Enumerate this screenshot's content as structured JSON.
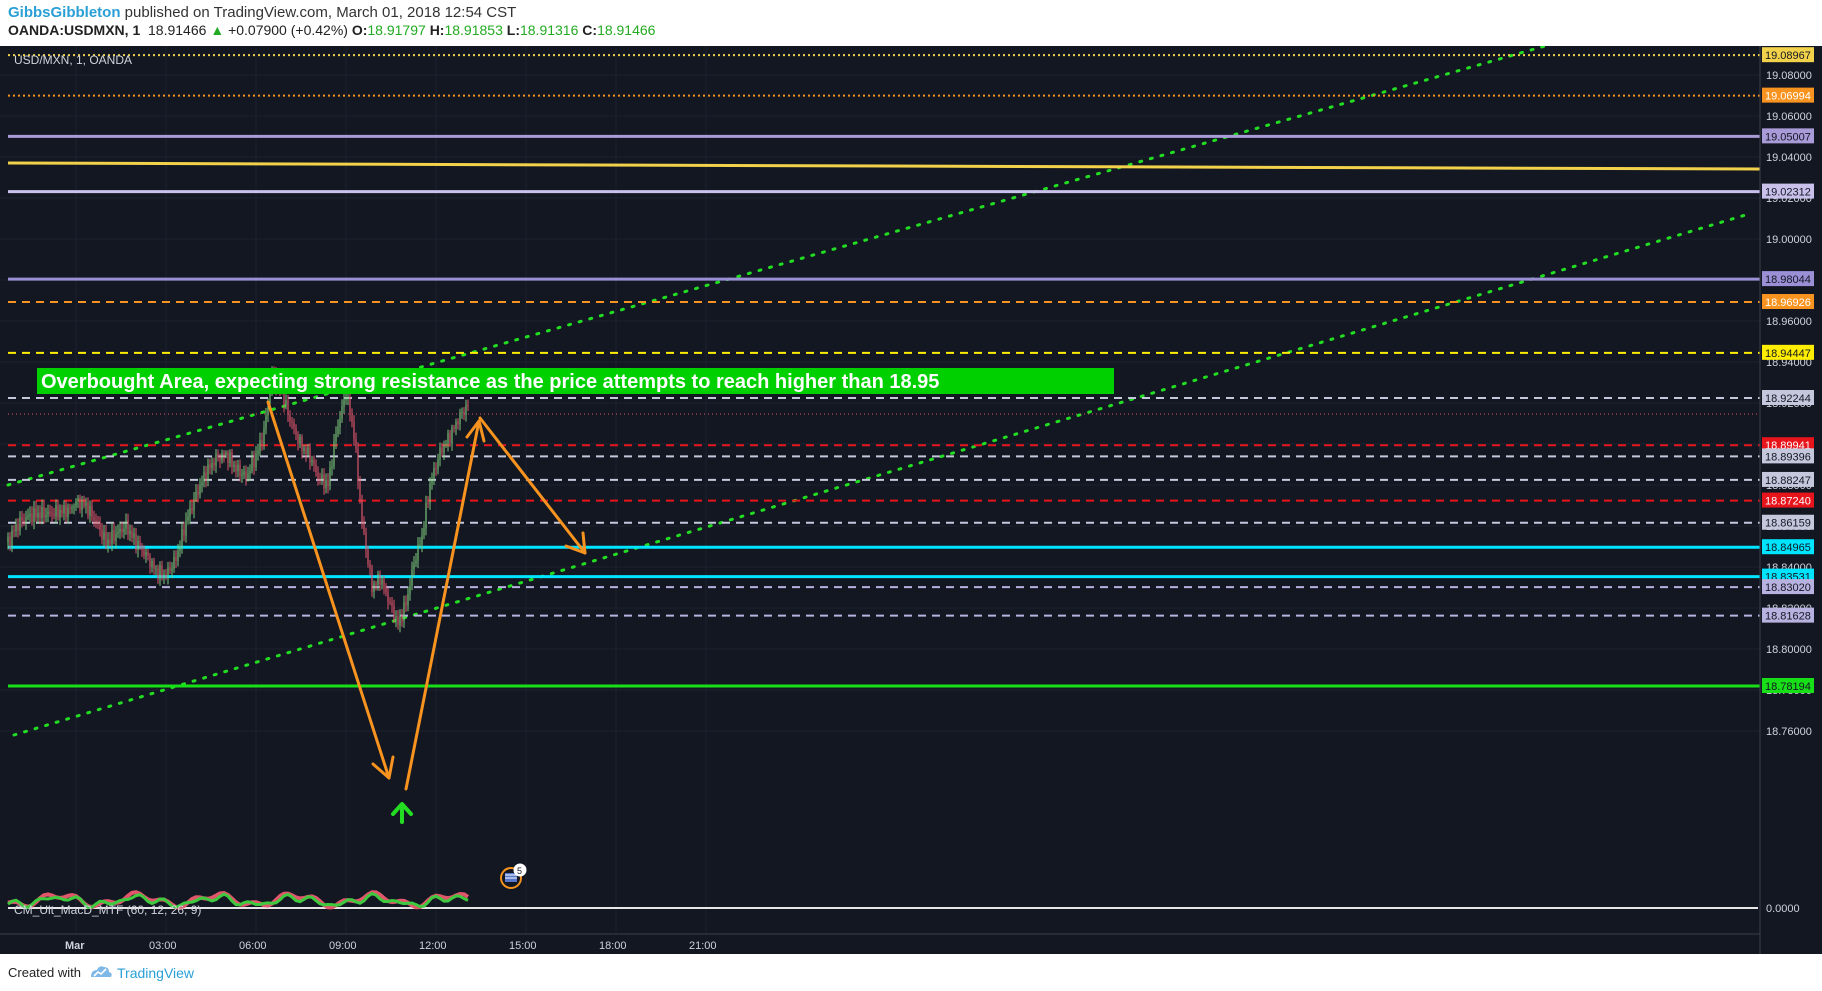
{
  "header": {
    "author": "GibbsGibbleton",
    "published_text": " published on TradingView.com, March 01, 2018 12:54 CST",
    "symbol": "OANDA:USDMXN, 1",
    "last": "18.91466",
    "change": "+0.07900 (+0.42%)",
    "open_label": "O:",
    "open": "18.91797",
    "high_label": "H:",
    "high": "18.91853",
    "low_label": "L:",
    "low": "18.91316",
    "close_label": "C:",
    "close": "18.91466"
  },
  "chart": {
    "pane_title": "USD/MXN, 1, OANDA",
    "annotation": "Overbought Area, expecting strong resistance as the price attempts to reach higher than 18.95",
    "indicator_label": "CM_Ult_MacD_MTF (60, 12, 26, 9)",
    "indicator_zero": "0.0000",
    "event_badge_count": "5",
    "price_axis": [
      "19.08000",
      "19.06000",
      "19.04000",
      "19.02000",
      "19.00000",
      "18.98000",
      "18.96000",
      "18.94000",
      "18.92000",
      "18.90000",
      "18.88000",
      "18.86000",
      "18.84000",
      "18.82000",
      "18.80000",
      "18.78000",
      "18.76000"
    ],
    "time_axis": [
      "Mar",
      "03:00",
      "06:00",
      "09:00",
      "12:00",
      "15:00",
      "18:00",
      "21:00"
    ],
    "levels": [
      {
        "value": "19.08967",
        "color": "#f2d24b",
        "style": "dotted"
      },
      {
        "value": "19.06994",
        "color": "#f7931e",
        "style": "dotted"
      },
      {
        "value": "19.05007",
        "color": "#a99bd8",
        "style": "solid"
      },
      {
        "value": "19.02312",
        "color": "#c9c1ec",
        "style": "solid"
      },
      {
        "value": "18.98044",
        "color": "#9b8fd6",
        "style": "solid"
      },
      {
        "value": "18.96926",
        "color": "#f7931e",
        "style": "dashed"
      },
      {
        "value": "18.94447",
        "color": "#ffee00",
        "style": "dashed"
      },
      {
        "value": "18.92244",
        "color": "#c5c8dd",
        "style": "dashed"
      },
      {
        "value": "18.89941",
        "color": "#e8141b",
        "style": "dashed"
      },
      {
        "value": "18.89396",
        "color": "#c5c8dd",
        "style": "dashed"
      },
      {
        "value": "18.88247",
        "color": "#c5c8dd",
        "style": "dashed"
      },
      {
        "value": "18.87240",
        "color": "#e8141b",
        "style": "dashed"
      },
      {
        "value": "18.86159",
        "color": "#c5c8dd",
        "style": "dashed"
      },
      {
        "value": "18.84965",
        "color": "#00e5ff",
        "style": "solid"
      },
      {
        "value": "18.83531",
        "color": "#00e5ff",
        "style": "solid"
      },
      {
        "value": "18.83020",
        "color": "#b7b2e0",
        "style": "dashed"
      },
      {
        "value": "18.81628",
        "color": "#b7b2e0",
        "style": "dashed"
      },
      {
        "value": "18.78194",
        "color": "#18e018",
        "style": "solid"
      }
    ],
    "colors": {
      "background": "#131722",
      "up": "#7bc67b",
      "down": "#e0566b",
      "trend": "#22dd22",
      "arrow": "#f7931e",
      "annotation_bg": "#00d000"
    }
  }
}
